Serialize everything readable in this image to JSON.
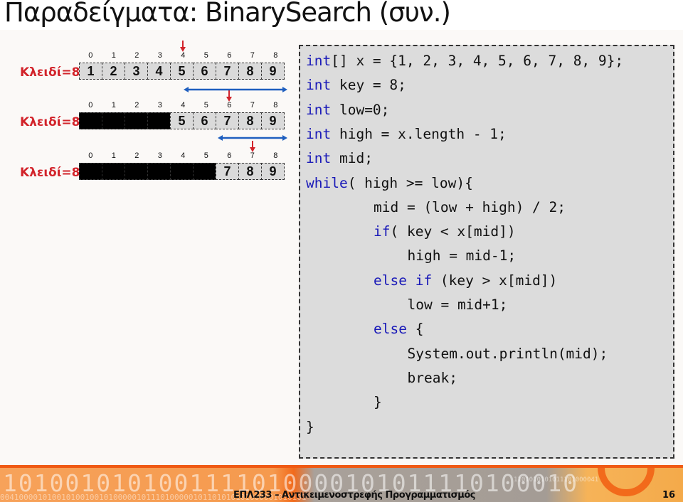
{
  "slide": {
    "title": "Παραδείγματα: BinarySearch (συν.)"
  },
  "search_steps": [
    {
      "key_label": "Κλειδί=8",
      "indices": [
        "0",
        "1",
        "2",
        "3",
        "4",
        "5",
        "6",
        "7",
        "8"
      ],
      "values": [
        "1",
        "2",
        "3",
        "4",
        "5",
        "6",
        "7",
        "8",
        "9"
      ],
      "eliminated": [
        false,
        false,
        false,
        false,
        false,
        false,
        false,
        false,
        false
      ],
      "mid_index": 4,
      "low": 0,
      "high": 8
    },
    {
      "key_label": "Κλειδί=8",
      "indices": [
        "0",
        "1",
        "2",
        "3",
        "4",
        "5",
        "6",
        "7",
        "8"
      ],
      "values": [
        "",
        "",
        "",
        "",
        "5",
        "6",
        "7",
        "8",
        "9"
      ],
      "eliminated": [
        true,
        true,
        true,
        true,
        false,
        false,
        false,
        false,
        false
      ],
      "mid_index": 6,
      "low": 4,
      "high": 8
    },
    {
      "key_label": "Κλειδί=8",
      "indices": [
        "0",
        "1",
        "2",
        "3",
        "4",
        "5",
        "6",
        "7",
        "8"
      ],
      "values": [
        "",
        "",
        "",
        "",
        "",
        "",
        "7",
        "8",
        "9"
      ],
      "eliminated": [
        true,
        true,
        true,
        true,
        true,
        true,
        false,
        false,
        false
      ],
      "mid_index": 7,
      "low": 6,
      "high": 8
    }
  ],
  "code": {
    "lines": [
      {
        "indent": 0,
        "parts": [
          {
            "t": "int",
            "kw": true
          },
          {
            "t": "[] x = {1, 2, 3, 4, 5, 6, 7, 8, 9};"
          }
        ]
      },
      {
        "indent": 0,
        "parts": [
          {
            "t": "int",
            "kw": true
          },
          {
            "t": " key = 8;"
          }
        ]
      },
      {
        "indent": 0,
        "parts": [
          {
            "t": "int",
            "kw": true
          },
          {
            "t": " low=0;"
          }
        ]
      },
      {
        "indent": 0,
        "parts": [
          {
            "t": "int",
            "kw": true
          },
          {
            "t": " high = x.length - 1;"
          }
        ]
      },
      {
        "indent": 0,
        "parts": [
          {
            "t": "int",
            "kw": true
          },
          {
            "t": " mid;"
          }
        ]
      },
      {
        "indent": 0,
        "parts": [
          {
            "t": "while",
            "kw": true
          },
          {
            "t": "( high >= low){"
          }
        ]
      },
      {
        "indent": 2,
        "parts": [
          {
            "t": "mid = (low + high) / 2;"
          }
        ]
      },
      {
        "indent": 2,
        "parts": [
          {
            "t": "if",
            "kw": true
          },
          {
            "t": "( key < x[mid])"
          }
        ]
      },
      {
        "indent": 3,
        "parts": [
          {
            "t": "high = mid-1;"
          }
        ]
      },
      {
        "indent": 2,
        "parts": [
          {
            "t": "else if",
            "kw": true
          },
          {
            "t": " (key > x[mid])"
          }
        ]
      },
      {
        "indent": 3,
        "parts": [
          {
            "t": "low = mid+1;"
          }
        ]
      },
      {
        "indent": 2,
        "parts": [
          {
            "t": "else",
            "kw": true
          },
          {
            "t": " {"
          }
        ]
      },
      {
        "indent": 3,
        "parts": [
          {
            "t": "System.out.println(mid);"
          }
        ]
      },
      {
        "indent": 3,
        "parts": [
          {
            "t": "break;"
          }
        ]
      },
      {
        "indent": 2,
        "parts": [
          {
            "t": "}"
          }
        ]
      },
      {
        "indent": 0,
        "parts": [
          {
            "t": "}"
          }
        ]
      }
    ]
  },
  "footer": {
    "course": "ΕΠΛ233 – Αντικειμενοστρεφής Προγραμματισμός",
    "page_number": "16",
    "binary_big": "1010010101001111010000101011110100010",
    "binary_small": "00410000101001010010010100000101110100000101101010101000001010101",
    "binary_small2": "1101010101011101000041"
  },
  "colors": {
    "key_label": "#d2232a",
    "mid_arrow": "#d2232a",
    "range_arrow": "#1f5fbf",
    "keyword": "#1a1ab8",
    "footer_orange": "#f05a14"
  }
}
